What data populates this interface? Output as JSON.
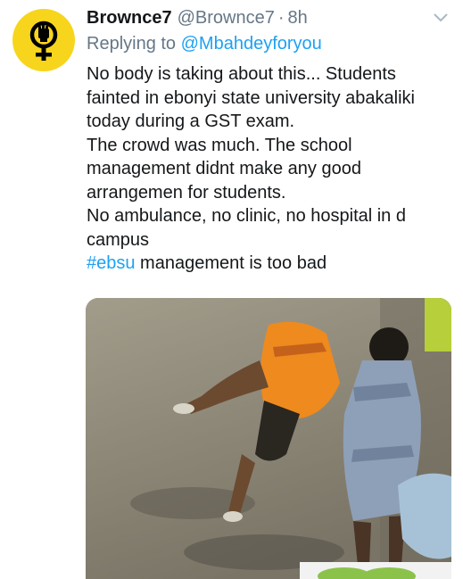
{
  "tweet": {
    "display_name": "Brownce7",
    "handle": "@Brownce7",
    "separator": "·",
    "time": "8h",
    "reply_prefix": "Replying to",
    "reply_user": "@Mbahdeyforyou",
    "lines": [
      "No body is taking about this... Students",
      "fainted in ebonyi state university abakaliki",
      "today during a GST exam.",
      "The crowd was much. The school",
      "management didnt make any good",
      "arrangemen for students.",
      "No ambulance, no clinic, no hospital in d",
      "campus"
    ],
    "hashtag": "#ebsu",
    "last_line_rest": " management is too bad",
    "avatar_icon": "venus-fist-icon",
    "menu_icon": "chevron-down-icon",
    "media_kind": "photo"
  },
  "colors": {
    "primary_text": "#14171a",
    "secondary_text": "#657786",
    "link": "#1da1f2",
    "avatar_bg": "#f7d51c"
  }
}
